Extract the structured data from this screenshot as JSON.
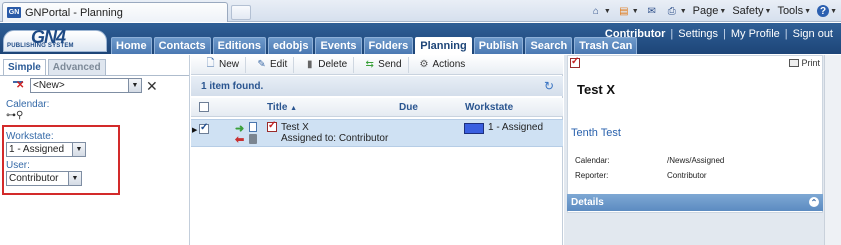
{
  "browser": {
    "tab_title": "GNPortal - Planning",
    "favicon_label": "GN",
    "commands": [
      {
        "label": "",
        "icon": "home-icon"
      },
      {
        "label": "",
        "icon": "feeds-icon"
      },
      {
        "label": "",
        "icon": "mail-icon"
      },
      {
        "label": "",
        "icon": "print-icon"
      },
      {
        "label": "Page",
        "icon": ""
      },
      {
        "label": "Safety",
        "icon": ""
      },
      {
        "label": "Tools",
        "icon": ""
      },
      {
        "label": "",
        "icon": "help-icon"
      }
    ]
  },
  "banner": {
    "logo_big": "GN4",
    "logo_small": "PUBLISHING SYSTEM",
    "tabs": [
      "Home",
      "Contacts",
      "Editions",
      "edobjs",
      "Events",
      "Folders",
      "Planning",
      "Publish",
      "Search",
      "Trash Can"
    ],
    "active_tab": "Planning",
    "user": "Contributor",
    "links": [
      "Settings",
      "My Profile",
      "Sign out"
    ]
  },
  "left": {
    "tabs": [
      "Simple",
      "Advanced"
    ],
    "active_tab": "Simple",
    "saved_filter_value": "<New>",
    "calendar_label": "Calendar:",
    "workstate_label": "Workstate:",
    "workstate_value": "1 - Assigned",
    "user_label": "User:",
    "user_value": "Contributor"
  },
  "middle": {
    "toolbar": [
      "New",
      "Edit",
      "Delete",
      "Send",
      "Actions"
    ],
    "items_found": "1 item found.",
    "columns": {
      "title": "Title",
      "due": "Due",
      "workstate": "Workstate"
    },
    "row": {
      "title": "Test X",
      "assigned": "Assigned to: Contributor",
      "due": "",
      "workstate": "1 - Assigned",
      "workstate_color": "#3a5fe0",
      "checked": true
    }
  },
  "right": {
    "print_label": "Print",
    "title": "Test X",
    "subtitle": "Tenth Test",
    "fields": [
      {
        "key": "Calendar:",
        "value": "/News/Assigned"
      },
      {
        "key": "Reporter:",
        "value": "Contributor"
      }
    ],
    "details_label": "Details"
  },
  "colors": {
    "banner": "#1d4578",
    "selected_row": "#cfe1f3",
    "highlight_box": "#d32a2a",
    "link": "#2a62ad"
  }
}
